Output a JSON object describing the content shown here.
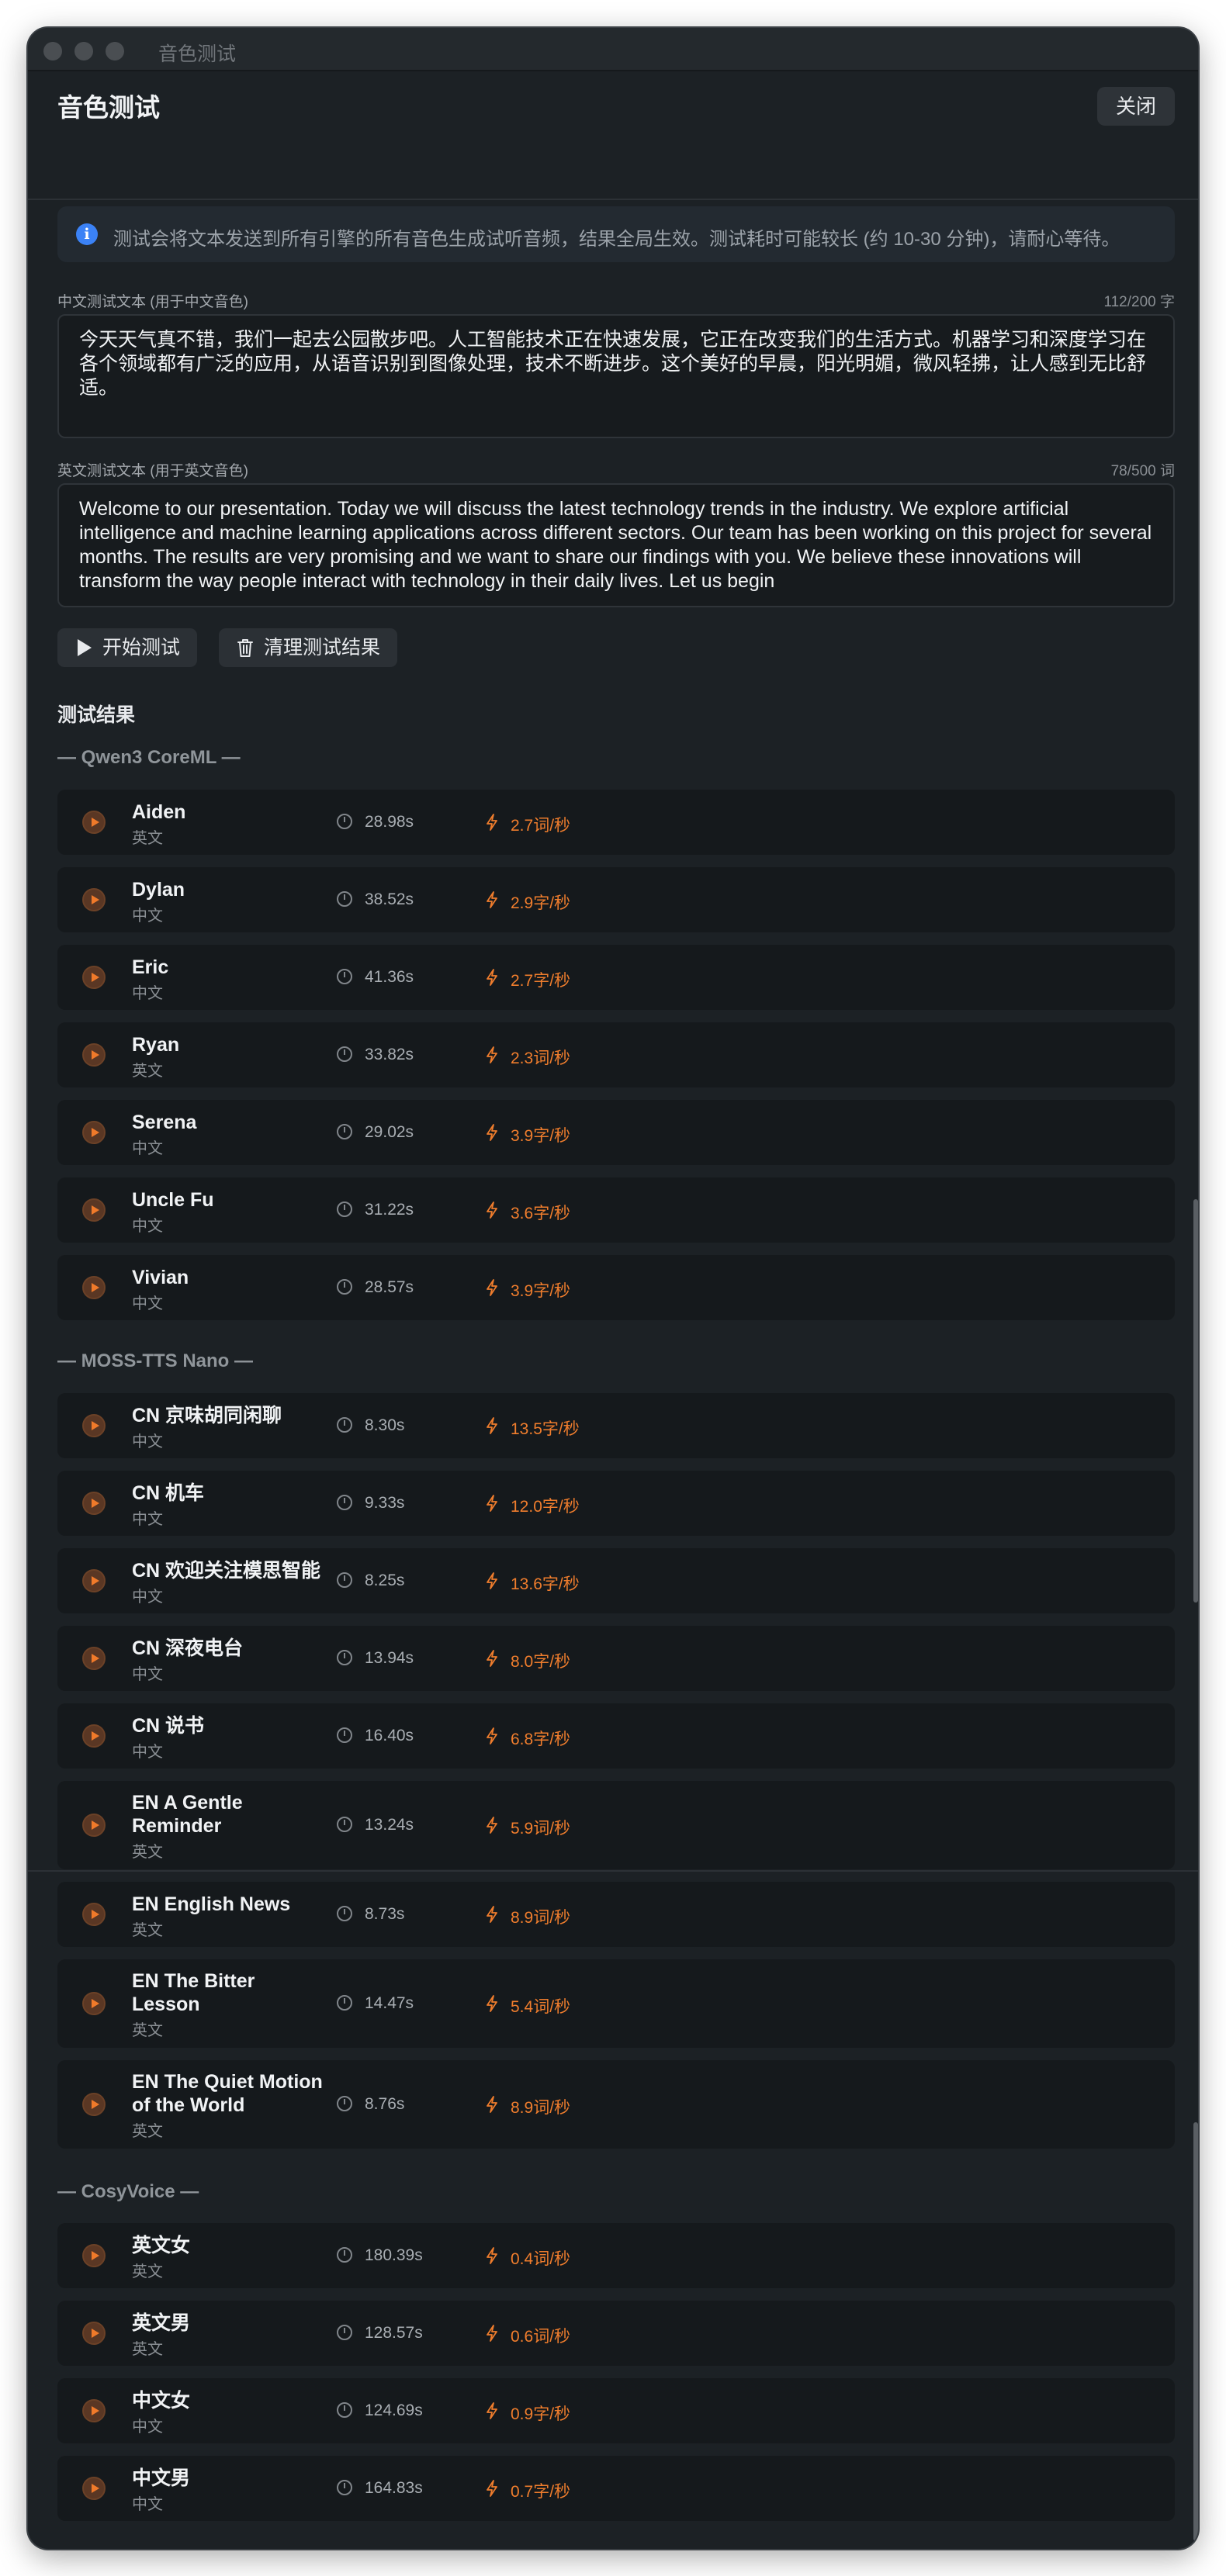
{
  "window": {
    "title": "音色测试"
  },
  "header": {
    "title": "音色测试",
    "close_label": "关闭"
  },
  "info": {
    "icon": "info-icon",
    "text": "测试会将文本发送到所有引擎的所有音色生成试听音频，结果全局生效。测试耗时可能较长 (约 10-30 分钟)，请耐心等待。"
  },
  "zh_field": {
    "label": "中文测试文本 (用于中文音色)",
    "count": "112/200 字",
    "value": "今天天气真不错，我们一起去公园散步吧。人工智能技术正在快速发展，它正在改变我们的生活方式。机器学习和深度学习在各个领域都有广泛的应用，从语音识别到图像处理，技术不断进步。这个美好的早晨，阳光明媚，微风轻拂，让人感到无比舒适。"
  },
  "en_field": {
    "label": "英文测试文本 (用于英文音色)",
    "count": "78/500 词",
    "value": "Welcome to our presentation. Today we will discuss the latest technology trends in the industry. We explore artificial intelligence and machine learning applications across different sectors. Our team has been working on this project for several months. The results are very promising and we want to share our findings with you. We believe these innovations will transform the way people interact with technology in their daily lives. Let us begin"
  },
  "actions": {
    "start_label": "开始测试",
    "clear_label": "清理测试结果"
  },
  "results_title": "测试结果",
  "groups": [
    {
      "title": "— Qwen3 CoreML —"
    },
    {
      "title": "— MOSS-TTS Nano —"
    },
    {
      "title": "— CosyVoice —"
    }
  ],
  "rows": [
    {
      "name": "Aiden",
      "lang": "英文",
      "duration": "28.98s",
      "speed": "2.7词/秒"
    },
    {
      "name": "Dylan",
      "lang": "中文",
      "duration": "38.52s",
      "speed": "2.9字/秒"
    },
    {
      "name": "Eric",
      "lang": "中文",
      "duration": "41.36s",
      "speed": "2.7字/秒"
    },
    {
      "name": "Ryan",
      "lang": "英文",
      "duration": "33.82s",
      "speed": "2.3词/秒"
    },
    {
      "name": "Serena",
      "lang": "中文",
      "duration": "29.02s",
      "speed": "3.9字/秒"
    },
    {
      "name": "Uncle Fu",
      "lang": "中文",
      "duration": "31.22s",
      "speed": "3.6字/秒"
    },
    {
      "name": "Vivian",
      "lang": "中文",
      "duration": "28.57s",
      "speed": "3.9字/秒"
    },
    {
      "name": "CN 京味胡同闲聊",
      "lang": "中文",
      "duration": "8.30s",
      "speed": "13.5字/秒"
    },
    {
      "name": "CN 机车",
      "lang": "中文",
      "duration": "9.33s",
      "speed": "12.0字/秒"
    },
    {
      "name": "CN 欢迎关注模思智能",
      "lang": "中文",
      "duration": "8.25s",
      "speed": "13.6字/秒"
    },
    {
      "name": "CN 深夜电台",
      "lang": "中文",
      "duration": "13.94s",
      "speed": "8.0字/秒"
    },
    {
      "name": "CN 说书",
      "lang": "中文",
      "duration": "16.40s",
      "speed": "6.8字/秒"
    },
    {
      "name": "EN A Gentle Reminder",
      "lang": "英文",
      "duration": "13.24s",
      "speed": "5.9词/秒"
    },
    {
      "name": "EN English News",
      "lang": "英文",
      "duration": "8.73s",
      "speed": "8.9词/秒"
    },
    {
      "name": "EN The Bitter Lesson",
      "lang": "英文",
      "duration": "14.47s",
      "speed": "5.4词/秒"
    },
    {
      "name": "EN The Quiet Motion of the World",
      "lang": "英文",
      "duration": "8.76s",
      "speed": "8.9词/秒"
    },
    {
      "name": "英文女",
      "lang": "英文",
      "duration": "180.39s",
      "speed": "0.4词/秒"
    },
    {
      "name": "英文男",
      "lang": "英文",
      "duration": "128.57s",
      "speed": "0.6词/秒"
    },
    {
      "name": "中文女",
      "lang": "中文",
      "duration": "124.69s",
      "speed": "0.9字/秒"
    },
    {
      "name": "中文男",
      "lang": "中文",
      "duration": "164.83s",
      "speed": "0.7字/秒"
    }
  ],
  "colors": {
    "accent": "#ef7d2d",
    "info": "#3b82f6",
    "background": "#1c2125",
    "row": "#15191c"
  }
}
